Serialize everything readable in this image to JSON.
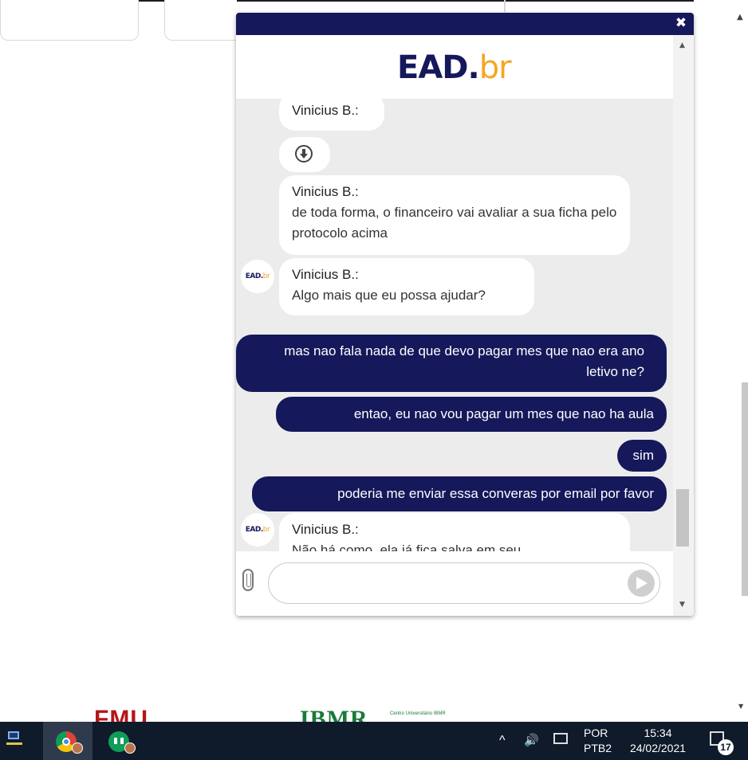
{
  "chat": {
    "brand_part1": "EAD.",
    "brand_part2": "br",
    "close_glyph": "✖",
    "messages": [
      {
        "from": "agent",
        "name": "Vinicius  B.:",
        "text": ""
      },
      {
        "from": "agent",
        "attachment": "download-icon"
      },
      {
        "from": "agent",
        "name": "Vinicius  B.:",
        "text": "de toda forma, o financeiro vai avaliar a sua ficha pelo protocolo acima"
      },
      {
        "from": "agent",
        "name": "Vinicius  B.:",
        "text": "Algo mais que eu possa ajudar?"
      },
      {
        "from": "user",
        "text": "mas nao fala nada de que devo pagar mes que nao era ano letivo ne?"
      },
      {
        "from": "user",
        "text": "entao, eu nao vou pagar um mes que nao ha aula"
      },
      {
        "from": "user",
        "text": "sim"
      },
      {
        "from": "user",
        "text": "poderia me enviar essa converas por email por favor"
      },
      {
        "from": "agent",
        "name": "Vinicius  B.:",
        "text": "Não há como, ela já fica salva em seu"
      }
    ],
    "avatar_part1": "EAD.",
    "avatar_part2": "br",
    "input_value": ""
  },
  "logos": {
    "fmu": "FMU",
    "ibmr": "IBMR",
    "ibmr_sub": "Centro Universitário IBMR"
  },
  "taskbar": {
    "lang_top": "POR",
    "lang_bottom": "PTB2",
    "time": "15:34",
    "date": "24/02/2021",
    "notification_count": "17",
    "chevron": "^",
    "volume": "🔊"
  },
  "colors": {
    "brand_navy": "#15185a",
    "brand_orange": "#f5a623",
    "taskbar": "#0f1a2a"
  }
}
